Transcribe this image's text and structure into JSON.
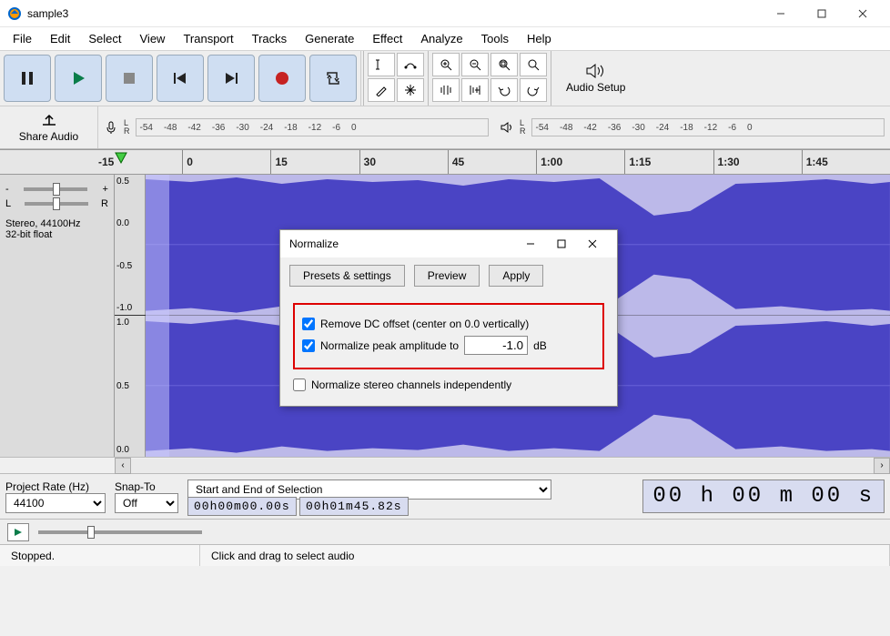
{
  "title": "sample3",
  "menu": [
    "File",
    "Edit",
    "Select",
    "View",
    "Transport",
    "Tracks",
    "Generate",
    "Effect",
    "Analyze",
    "Tools",
    "Help"
  ],
  "toolbar": {
    "audio_setup": "Audio Setup",
    "share": "Share Audio"
  },
  "meter": {
    "ticks": [
      "-54",
      "-48",
      "-42",
      "-36",
      "-30",
      "-24",
      "-18",
      "-12",
      "-6",
      "0"
    ]
  },
  "timeline": [
    "-15",
    "0",
    "15",
    "30",
    "45",
    "1:00",
    "1:15",
    "1:30",
    "1:45"
  ],
  "track": {
    "gain_minus": "-",
    "gain_plus": "+",
    "pan_l": "L",
    "pan_r": "R",
    "info1": "Stereo, 44100Hz",
    "info2": "32-bit float",
    "ruler": [
      "0.5",
      "0.0",
      "-0.5",
      "-1.0",
      "1.0",
      "0.5",
      "0.0"
    ]
  },
  "selection": {
    "project_rate_label": "Project Rate (Hz)",
    "project_rate": "44100",
    "snap_label": "Snap-To",
    "snap": "Off",
    "range_label": "Start and End of Selection",
    "start": "00h00m00.00s",
    "end": "00h01m45.82s",
    "position": "00 h 00 m 00 s"
  },
  "status": {
    "state": "Stopped.",
    "hint": "Click and drag to select audio"
  },
  "dialog": {
    "title": "Normalize",
    "presets": "Presets & settings",
    "preview": "Preview",
    "apply": "Apply",
    "remove_dc": "Remove DC offset (center on 0.0 vertically)",
    "normalize_peak": "Normalize peak amplitude to",
    "peak_value": "-1.0",
    "db": "dB",
    "stereo_indep": "Normalize stereo channels independently"
  }
}
